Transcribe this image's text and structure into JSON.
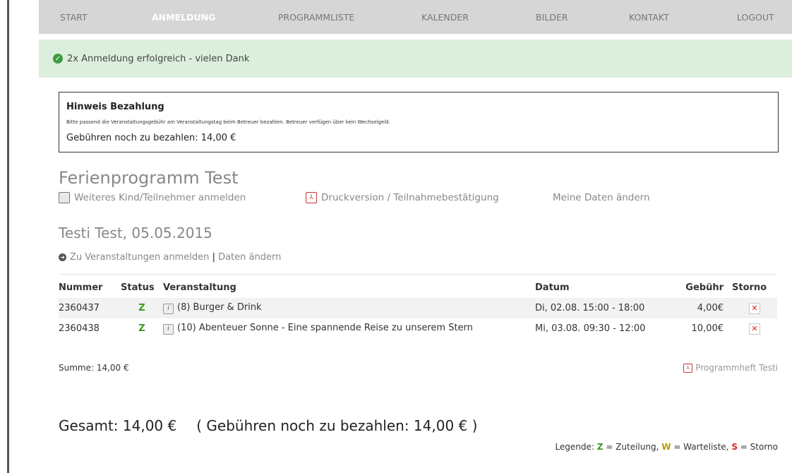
{
  "nav": {
    "items": [
      "START",
      "ANMELDUNG",
      "PROGRAMMLISTE",
      "KALENDER",
      "BILDER",
      "KONTAKT",
      "LOGOUT"
    ]
  },
  "success": {
    "message": "2x Anmeldung erfolgreich - vielen Dank"
  },
  "hint": {
    "title": "Hinweis Bezahlung",
    "text": "Bitte passend die Veranstaltungsgebühr am Veranstaltungstag beim Betreuer bezahlen. Betreuer verfügen über kein Wechselgeld.",
    "fee": "Gebühren noch zu bezahlen: 14,00 €"
  },
  "program": {
    "title": "Ferienprogramm Test",
    "actions": [
      "Weiteres Kind/Teilnehmer anmelden",
      "Druckversion / Teilnahmebestätigung",
      "Meine Daten ändern"
    ]
  },
  "person": {
    "name": "Testi Test, 05.05.2015",
    "link_events": "Zu Veranstaltungen anmelden",
    "separator": "|",
    "link_data": "Daten ändern"
  },
  "table": {
    "headers": [
      "Nummer",
      "Status",
      "Veranstaltung",
      "Datum",
      "Gebühr",
      "Storno"
    ],
    "rows": [
      {
        "nummer": "2360437",
        "status": "Z",
        "veranstaltung": "(8) Burger & Drink",
        "datum": "Di, 02.08. 15:00 - 18:00",
        "gebuehr": "4,00€"
      },
      {
        "nummer": "2360438",
        "status": "Z",
        "veranstaltung": "(10) Abenteuer Sonne - Eine spannende Reise zu unserem Stern",
        "datum": "Mi, 03.08. 09:30 - 12:00",
        "gebuehr": "10,00€"
      }
    ]
  },
  "summary": {
    "sum": "Summe: 14,00 €",
    "programmheft": "Programmheft Testi",
    "gesamt": "Gesamt: 14,00 €",
    "gesamt_fee": "( Gebühren noch zu bezahlen: 14,00 € )"
  },
  "legend": {
    "prefix": "Legende:",
    "z": "Z",
    "z_text": "= Zuteilung,",
    "w": "W",
    "w_text": "= Warteliste,",
    "s": "S",
    "s_text": "= Storno"
  },
  "colors": {
    "nav_bg": "#d6d6d6",
    "success_bg": "#dcefdd",
    "status_green": "#3a9a1c",
    "storno_red": "#e02020"
  }
}
